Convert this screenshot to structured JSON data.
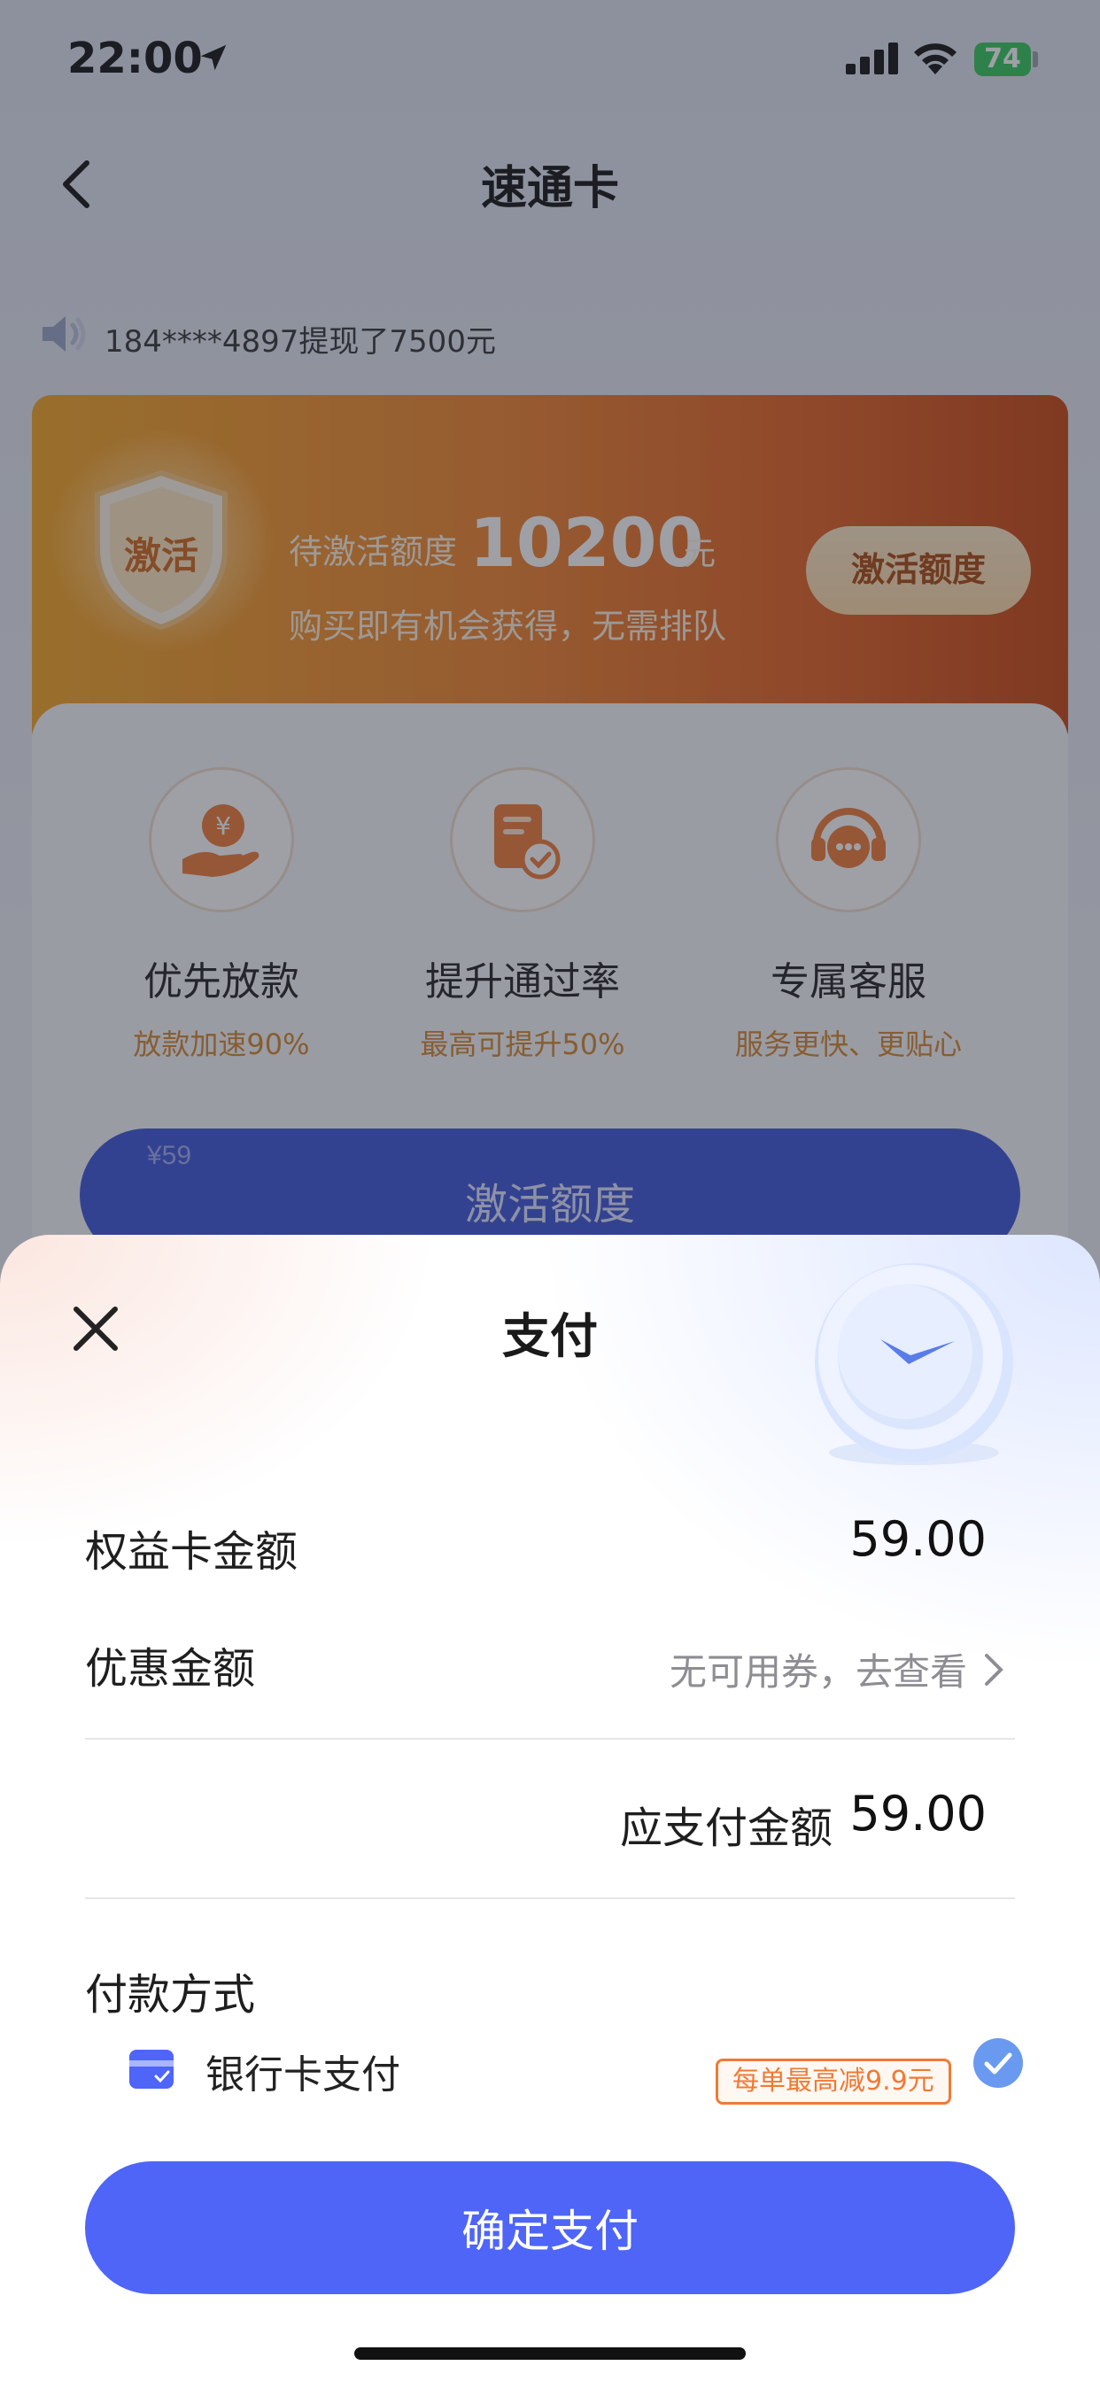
{
  "status_bar": {
    "time": "22:00",
    "battery": "74"
  },
  "nav": {
    "title": "速通卡"
  },
  "notice": {
    "text": "184****4897提现了7500元"
  },
  "promo": {
    "badge": "激活",
    "prefix": "待激活额度",
    "amount": "10200",
    "unit": "元",
    "subtitle": "购买即有机会获得，无需排队",
    "button": "激活额度"
  },
  "benefits": [
    {
      "title": "优先放款",
      "subtitle": "放款加速90%",
      "icon": "money-hand-icon"
    },
    {
      "title": "提升通过率",
      "subtitle": "最高可提升50%",
      "icon": "document-check-icon"
    },
    {
      "title": "专属客服",
      "subtitle": "服务更快、更贴心",
      "icon": "headset-chat-icon"
    }
  ],
  "activate_button": {
    "price": "¥59",
    "label": "激活额度"
  },
  "sheet": {
    "title": "支付",
    "card_amount_label": "权益卡金额",
    "card_amount_value": "59.00",
    "discount_label": "优惠金额",
    "discount_value": "无可用券，去查看",
    "due_label": "应支付金额",
    "due_value": "59.00",
    "payment_method_title": "付款方式",
    "payment_method": {
      "label": "银行卡支付",
      "tag": "每单最高减9.9元",
      "selected": true
    },
    "confirm_button": "确定支付"
  },
  "colors": {
    "primary": "#4e65f8",
    "promo_orange": "#f2832a",
    "tag_orange": "#f07a35",
    "check_blue": "#6a9af0"
  }
}
